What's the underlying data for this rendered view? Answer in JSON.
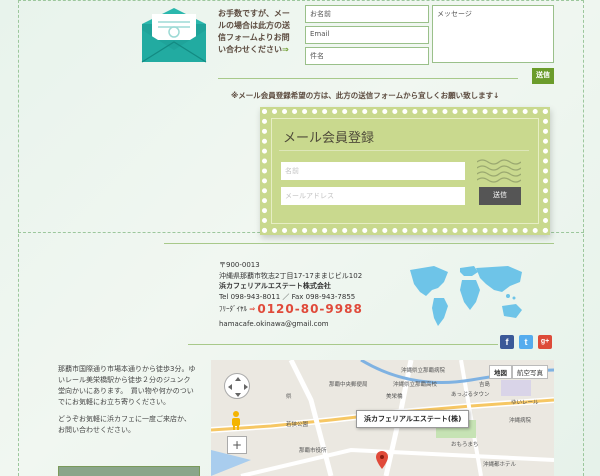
{
  "contact": {
    "note_lines": [
      "お手数ですが、メー",
      "ルの場合は此方の送",
      "信フォームよりお問",
      "い合わせください"
    ],
    "note_arrow": "⇒",
    "name_placeholder": "お名前",
    "email_placeholder": "Email",
    "subject_placeholder": "件名",
    "message_placeholder": "メッセージ",
    "send_label": "送信"
  },
  "member_note": "※メール会員登録希望の方は、此方の送信フォームから宜しくお願い致します↓",
  "member_form": {
    "title": "メール会員登録",
    "name_placeholder": "名前",
    "email_placeholder": "メールアドレス",
    "send_label": "送信"
  },
  "company": {
    "postal": "〒900-0013",
    "address": "沖縄県那覇市牧志2丁目17-17ままじビル102",
    "name": "浜カフェリアルエステート株式会社",
    "tel_fax": "Tel 098-943-8011 ／ Fax 098-943-7855",
    "freedial_label": "ﾌﾘｰﾀﾞｲﾔﾙ",
    "freedial_arrow": "⇒",
    "freedial_number": "0120-80-9988",
    "email": "hamacafe.okinawa@gmail.com"
  },
  "social": [
    {
      "icon": "facebook-icon",
      "glyph": "f",
      "color": "#3b5998"
    },
    {
      "icon": "twitter-icon",
      "glyph": "t",
      "color": "#55acee"
    },
    {
      "icon": "google-plus-icon",
      "glyph": "g+",
      "color": "#dd4b39"
    }
  ],
  "access": {
    "paragraph1": "那覇市国際通り市場本通りから徒歩3分。ゆいレール美栄橋駅から徒歩２分のジュンク堂向かいにあります。　買い物や何かのついでにお気軽にお立ち寄りください。",
    "paragraph2": "どうぞお気軽に浜カフェに一度ご来店か、お問い合わせください。"
  },
  "map": {
    "btn_map": "地図",
    "btn_satellite": "航空写真",
    "callout": "浜カフェリアルエステート(株)",
    "labels": [
      "沖縄県立那覇病院",
      "ゆいレール",
      "美栄橋",
      "沖縄県立那覇高校",
      "吉島",
      "あっぷるタウン",
      "那覇中央郵便局",
      "沖縄病院",
      "おもろまち",
      "那覇市役所",
      "若狭公園",
      "県",
      "沖縄都ホテル"
    ],
    "zoom_in": "+"
  },
  "colors": {
    "accent_green": "#6b9c2b",
    "stamp_bg": "#c9d98e",
    "freedial_red": "#e04a3a",
    "map_pin": "#e04a3a"
  }
}
